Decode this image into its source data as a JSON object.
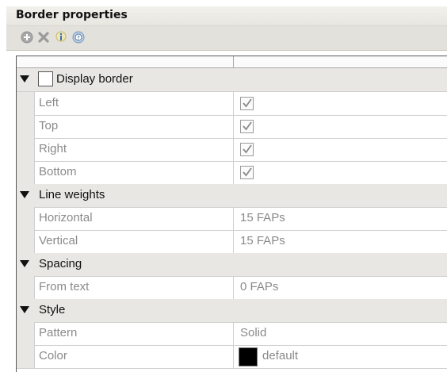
{
  "panel": {
    "title": "Border properties"
  },
  "toolbar": {
    "buttons": [
      {
        "icon": "add-icon"
      },
      {
        "icon": "delete-icon"
      },
      {
        "icon": "info-icon"
      },
      {
        "icon": "help-icon"
      }
    ]
  },
  "grid": {
    "sections": [
      {
        "label": "Display border",
        "checked": false,
        "rows": [
          {
            "label": "Left",
            "value_type": "checkbox",
            "checked": true
          },
          {
            "label": "Top",
            "value_type": "checkbox",
            "checked": true
          },
          {
            "label": "Right",
            "value_type": "checkbox",
            "checked": true
          },
          {
            "label": "Bottom",
            "value_type": "checkbox",
            "checked": true
          }
        ]
      },
      {
        "label": "Line weights",
        "rows": [
          {
            "label": "Horizontal",
            "value": "15 FAPs"
          },
          {
            "label": "Vertical",
            "value": "15 FAPs"
          }
        ]
      },
      {
        "label": "Spacing",
        "rows": [
          {
            "label": "From text",
            "value": "0 FAPs"
          }
        ]
      },
      {
        "label": "Style",
        "rows": [
          {
            "label": "Pattern",
            "value": "Solid"
          },
          {
            "label": "Color",
            "value": "default",
            "swatch": "#000000"
          }
        ]
      }
    ]
  }
}
